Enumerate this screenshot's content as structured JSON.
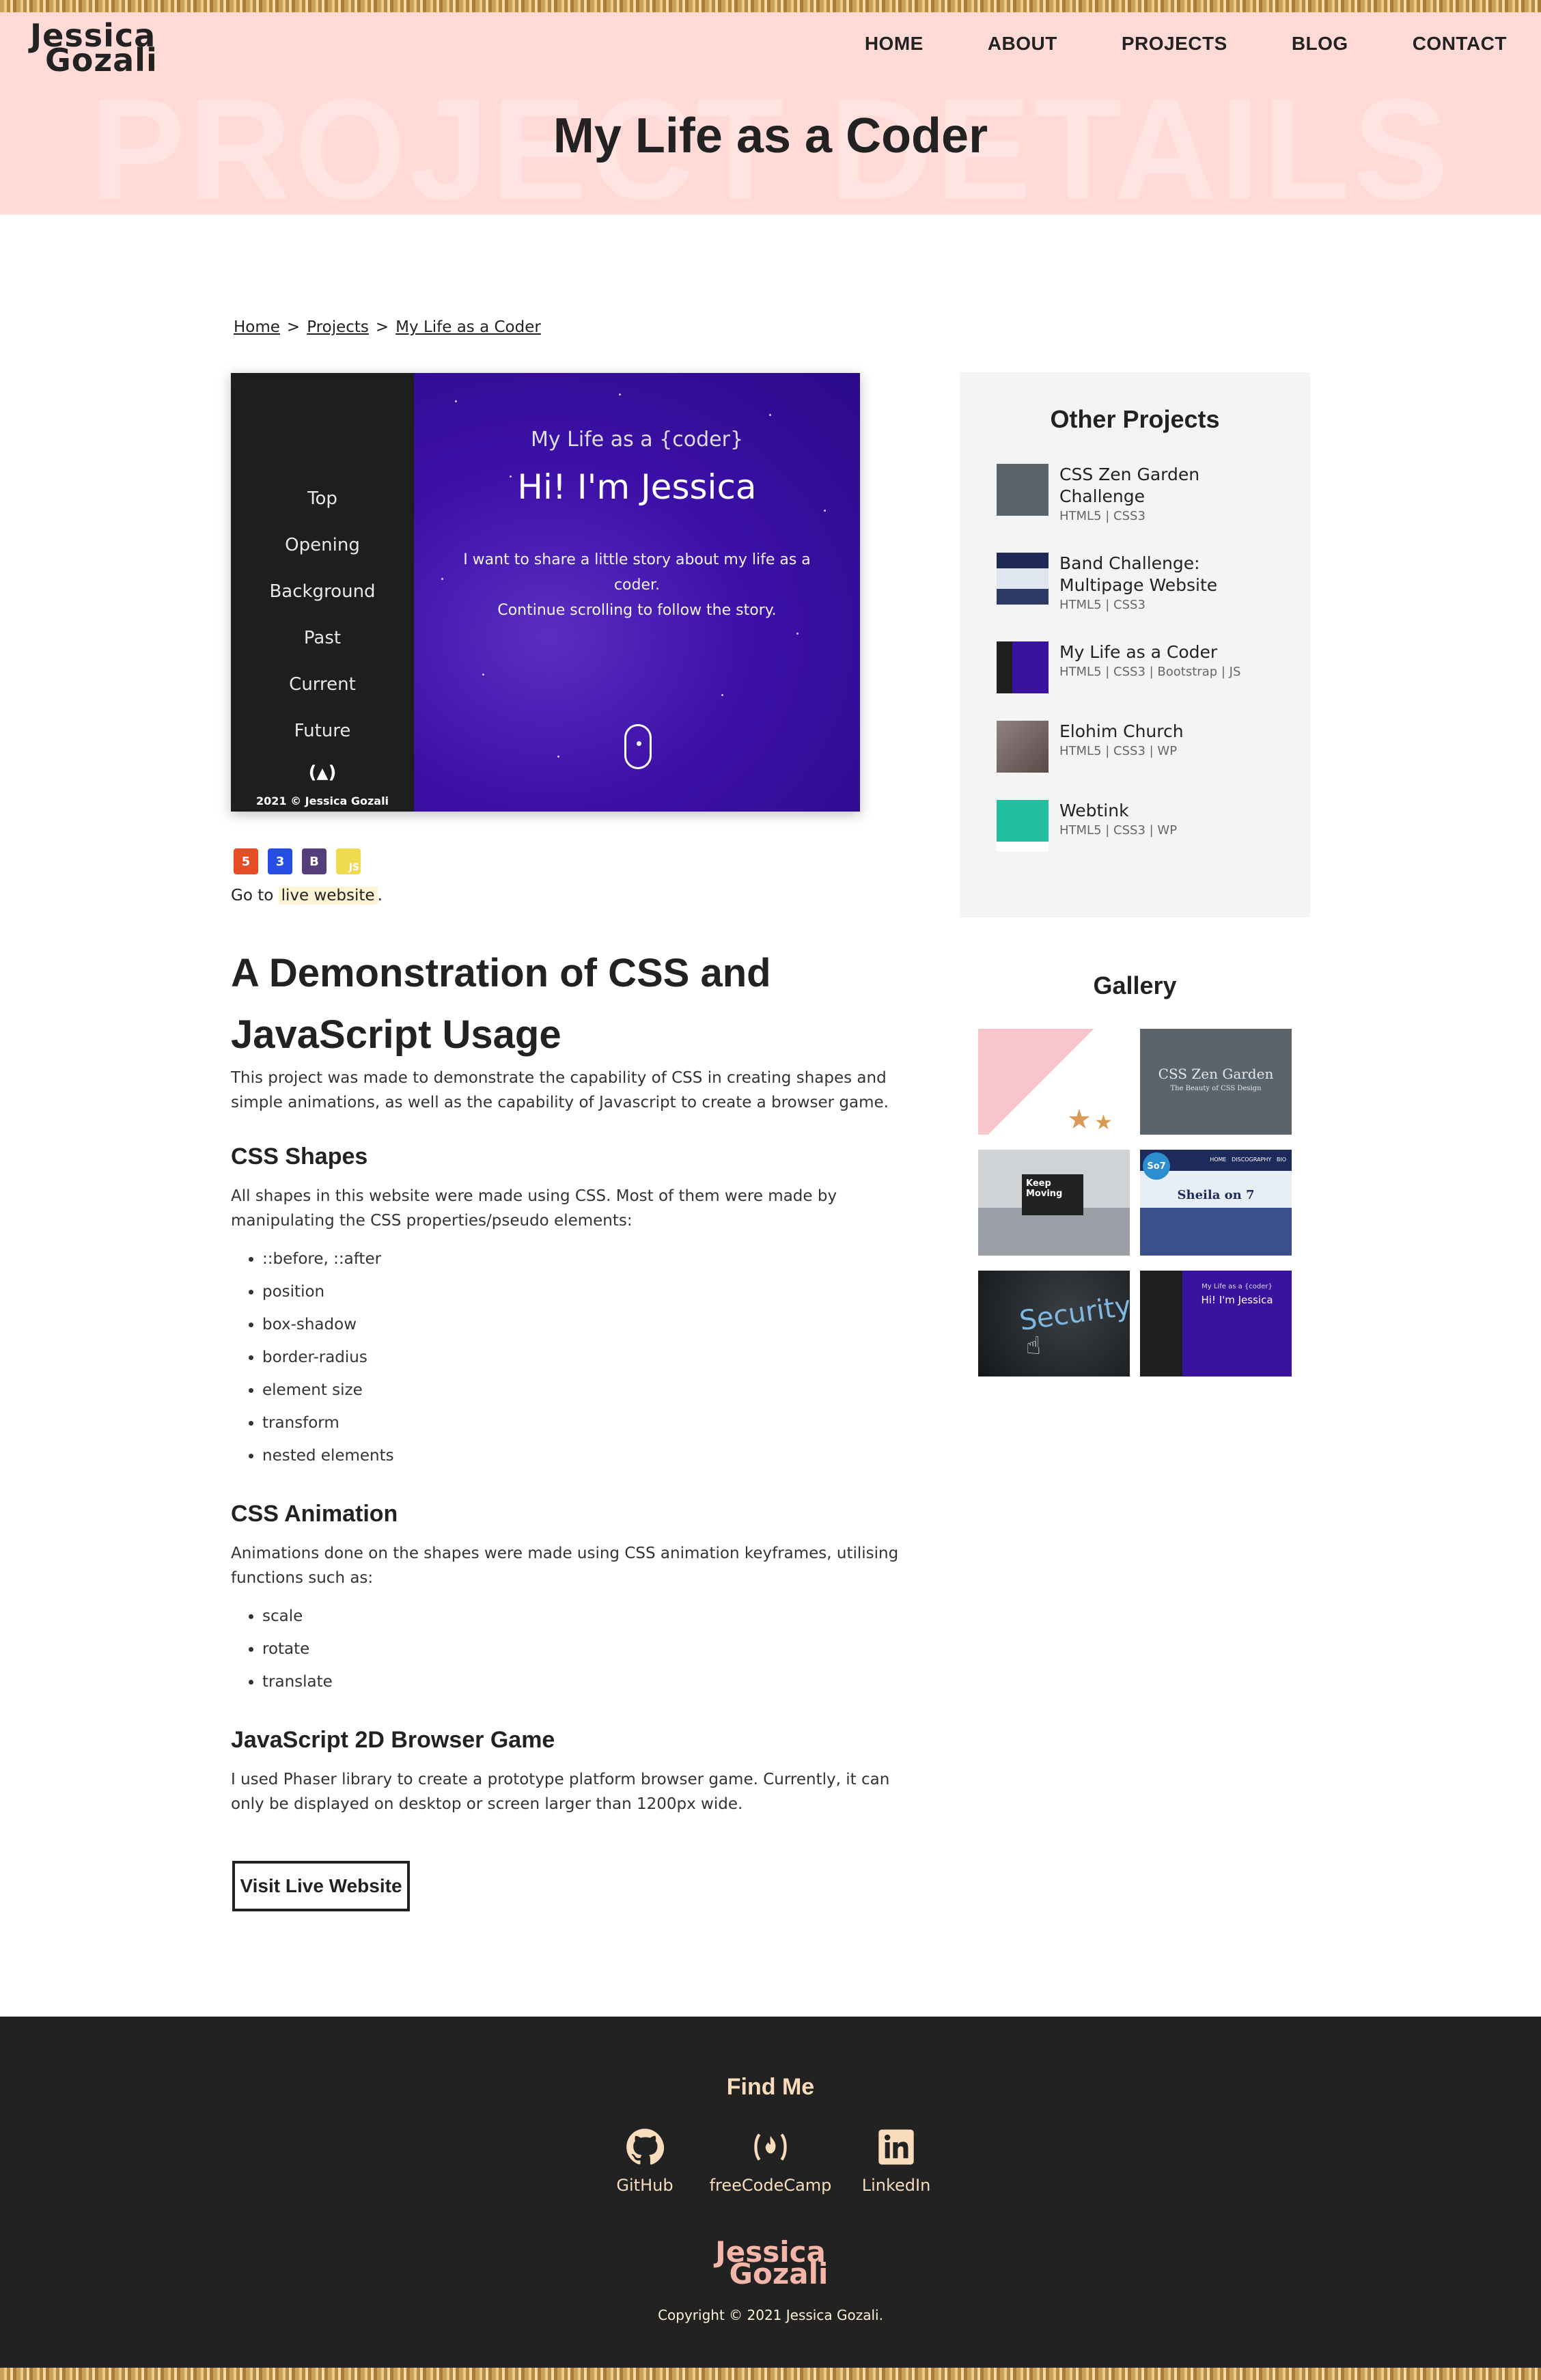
{
  "brand": {
    "logo_line1": "Jessica",
    "logo_line2": "Gozali"
  },
  "nav": {
    "items": [
      "HOME",
      "ABOUT",
      "PROJECTS",
      "BLOG",
      "CONTACT"
    ]
  },
  "hero": {
    "background_text": "PROJECT DETAILS",
    "title": "My Life as a Coder"
  },
  "breadcrumb": {
    "home": "Home",
    "projects": "Projects",
    "current": "My Life as a Coder",
    "separator": ">"
  },
  "preview": {
    "menu": [
      "Top",
      "Opening",
      "Background",
      "Past",
      "Current",
      "Future"
    ],
    "fcc_symbol": "(🔥)",
    "copyright": "2021 © Jessica Gozali",
    "subtitle": "My Life as a {coder}",
    "headline": "Hi! I'm Jessica",
    "text_line1": "I want to share a little story about my life as a coder.",
    "text_line2": "Continue scrolling to follow the story."
  },
  "tech_icons": [
    {
      "name": "html5-icon",
      "glyph": "5",
      "color": "#e44d26"
    },
    {
      "name": "css3-icon",
      "glyph": "3",
      "color": "#264de4"
    },
    {
      "name": "bootstrap-icon",
      "glyph": "B",
      "color": "#563d7c"
    },
    {
      "name": "javascript-icon",
      "glyph": "JS",
      "color": "#f0db4f"
    }
  ],
  "live_link": {
    "prefix": "Go to",
    "label": "live website",
    "suffix": "."
  },
  "article": {
    "heading": "A Demonstration of CSS and JavaScript Usage",
    "intro": "This project was made to demonstrate the capability of CSS in creating shapes and simple animations, as well as the capability of Javascript to create a browser game.",
    "shapes_heading": "CSS Shapes",
    "shapes_text": "All shapes in this website were made using CSS. Most of them were made by manipulating the CSS properties/pseudo elements:",
    "shapes_list": [
      "::before, ::after",
      "position",
      "box-shadow",
      "border-radius",
      "element size",
      "transform",
      "nested elements"
    ],
    "anim_heading": "CSS Animation",
    "anim_text": "Animations done on the shapes were made using CSS animation keyframes, utilising functions such as:",
    "anim_list": [
      "scale",
      "rotate",
      "translate"
    ],
    "game_heading": "JavaScript 2D Browser Game",
    "game_text": "I used  Phaser  library to create a prototype platform browser game. Currently, it can only be displayed on desktop or screen larger than 1200px wide.",
    "visit_button": "Visit Live Website"
  },
  "other_projects": {
    "title": "Other Projects",
    "items": [
      {
        "title": "CSS Zen Garden Challenge",
        "tags": "HTML5 | CSS3",
        "thumb_color": "#5b636b"
      },
      {
        "title": "Band Challenge: Multipage Website",
        "tags": "HTML5 | CSS3",
        "thumb_color": "#2d3a66"
      },
      {
        "title": "My Life as a Coder",
        "tags": "HTML5 | CSS3 | Bootstrap | JS",
        "thumb_color": "#3a12a0"
      },
      {
        "title": "Elohim Church",
        "tags": "HTML5 | CSS3 | WP",
        "thumb_color": "#6e5a55"
      },
      {
        "title": "Webtink",
        "tags": "HTML5 | CSS3 | WP",
        "thumb_color": "#1fbf9f"
      }
    ]
  },
  "gallery": {
    "title": "Gallery",
    "items": [
      {
        "name": "gallery-image-desk-pink",
        "label": ""
      },
      {
        "name": "gallery-image-css-zen-garden",
        "label": "CSS Zen Garden",
        "sublabel": "The Beauty of CSS Design"
      },
      {
        "name": "gallery-image-keep-moving",
        "label": "Keep Moving"
      },
      {
        "name": "gallery-image-sheila-on-7",
        "label": "Sheila on 7",
        "badge": "So7",
        "menu": "HOME   DISCOGRAPHY   BIO"
      },
      {
        "name": "gallery-image-security",
        "label": "Security"
      },
      {
        "name": "gallery-image-my-life-coder",
        "label": "Hi! I'm Jessica",
        "sublabel": "My Life as a {coder}"
      }
    ]
  },
  "footer": {
    "title": "Find Me",
    "socials": [
      {
        "name": "github",
        "label": "GitHub"
      },
      {
        "name": "freecodecamp",
        "label": "freeCodeCamp"
      },
      {
        "name": "linkedin",
        "label": "LinkedIn"
      }
    ],
    "logo_line1": "Jessica",
    "logo_line2": "Gozali",
    "copyright": "Copyright © 2021 Jessica Gozali."
  },
  "colors": {
    "hero_bg": "#ffdad7",
    "footer_bg": "#222222",
    "accent": "#f9dcbc",
    "preview_purple": "#3d10a8"
  }
}
